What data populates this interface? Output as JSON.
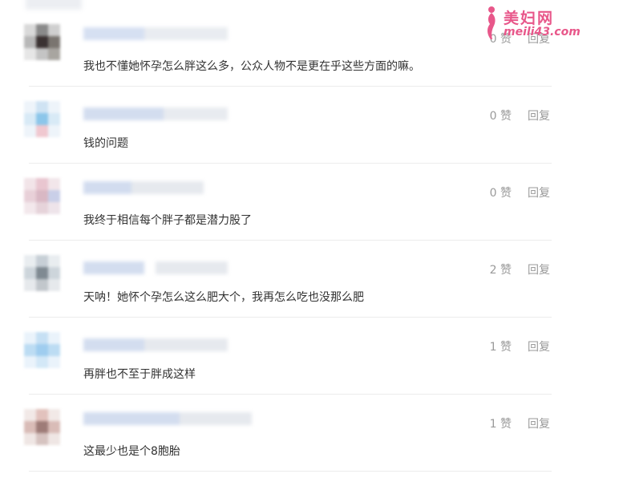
{
  "watermark": {
    "title": "美妇网",
    "url": "meili43.com"
  },
  "reply_label": "回复",
  "comments": [
    {
      "likes": "0 赞",
      "text": "我也不懂她怀孕怎么胖这么多，公众人物不是更在乎这些方面的嘛。"
    },
    {
      "likes": "0 赞",
      "text": "钱的问题"
    },
    {
      "likes": "0 赞",
      "text": "我终于相信每个胖子都是潜力股了"
    },
    {
      "likes": "2 赞",
      "text": "天呐！她怀个孕怎么这么肥大个，我再怎么吃也没那么肥"
    },
    {
      "likes": "1 赞",
      "text": "再胖也不至于胖成这样"
    },
    {
      "likes": "1 赞",
      "text": "这最少也是个8胞胎"
    }
  ],
  "colors": {
    "text": "#333333",
    "muted": "#9a9a9a",
    "divider": "#ececec",
    "watermark": "#e8578a"
  }
}
